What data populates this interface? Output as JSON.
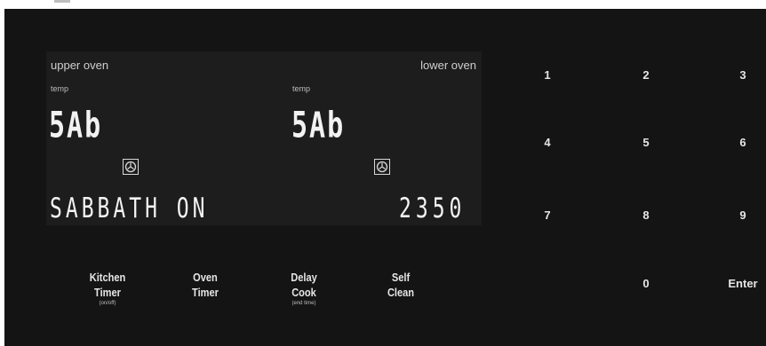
{
  "display": {
    "upper_label": "upper oven",
    "lower_label": "lower oven",
    "upper_temp_label": "temp",
    "lower_temp_label": "temp",
    "upper_readout": "5Ab",
    "lower_readout": "5Ab",
    "upper_icon": "oven-fan-icon",
    "lower_icon": "oven-fan-icon",
    "bottom_left": "SABBATH ON",
    "bottom_right": "2350"
  },
  "keypad": [
    "1",
    "2",
    "3",
    "4",
    "5",
    "6",
    "7",
    "8",
    "9",
    "0",
    "Enter"
  ],
  "buttons": {
    "kitchen_timer": {
      "line1": "Kitchen",
      "line2": "Timer",
      "sub": "(on/off)"
    },
    "oven_timer": {
      "line1": "Oven",
      "line2": "Timer"
    },
    "delay_cook": {
      "line1": "Delay",
      "line2": "Cook",
      "sub": "(end time)"
    },
    "self_clean": {
      "line1": "Self",
      "line2": "Clean"
    }
  },
  "colors": {
    "panel": "#141414",
    "display": "#1d1d1d",
    "segment": "#f2f2f2"
  }
}
